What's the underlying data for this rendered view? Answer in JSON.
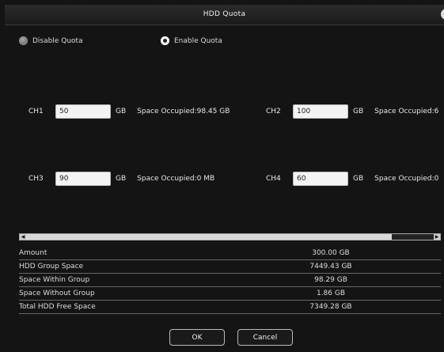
{
  "window": {
    "title": "HDD Quota",
    "close_icon": "close-icon"
  },
  "quota_mode": {
    "options": [
      {
        "label": "Disable Quota",
        "selected": false
      },
      {
        "label": "Enable Quota",
        "selected": true
      }
    ]
  },
  "channels": [
    {
      "label": "CH1",
      "value": "50",
      "unit": "GB",
      "occupied": "Space Occupied:98.45 GB"
    },
    {
      "label": "CH2",
      "value": "100",
      "unit": "GB",
      "occupied": "Space Occupied:6"
    },
    {
      "label": "CH3",
      "value": "90",
      "unit": "GB",
      "occupied": "Space Occupied:0 MB"
    },
    {
      "label": "CH4",
      "value": "60",
      "unit": "GB",
      "occupied": "Space Occupied:0"
    }
  ],
  "summary": [
    {
      "label": "Amount",
      "value": "300.00 GB"
    },
    {
      "label": "HDD Group Space",
      "value": "7449.43 GB"
    },
    {
      "label": "Space Within Group",
      "value": "98.29 GB"
    },
    {
      "label": "Space Without Group",
      "value": "1.86 GB"
    },
    {
      "label": "Total HDD Free Space",
      "value": "7349.28 GB"
    }
  ],
  "buttons": {
    "ok": "OK",
    "cancel": "Cancel"
  },
  "colors": {
    "background": "#141414",
    "text": "#ffffff",
    "input": "#f3f3f3"
  }
}
